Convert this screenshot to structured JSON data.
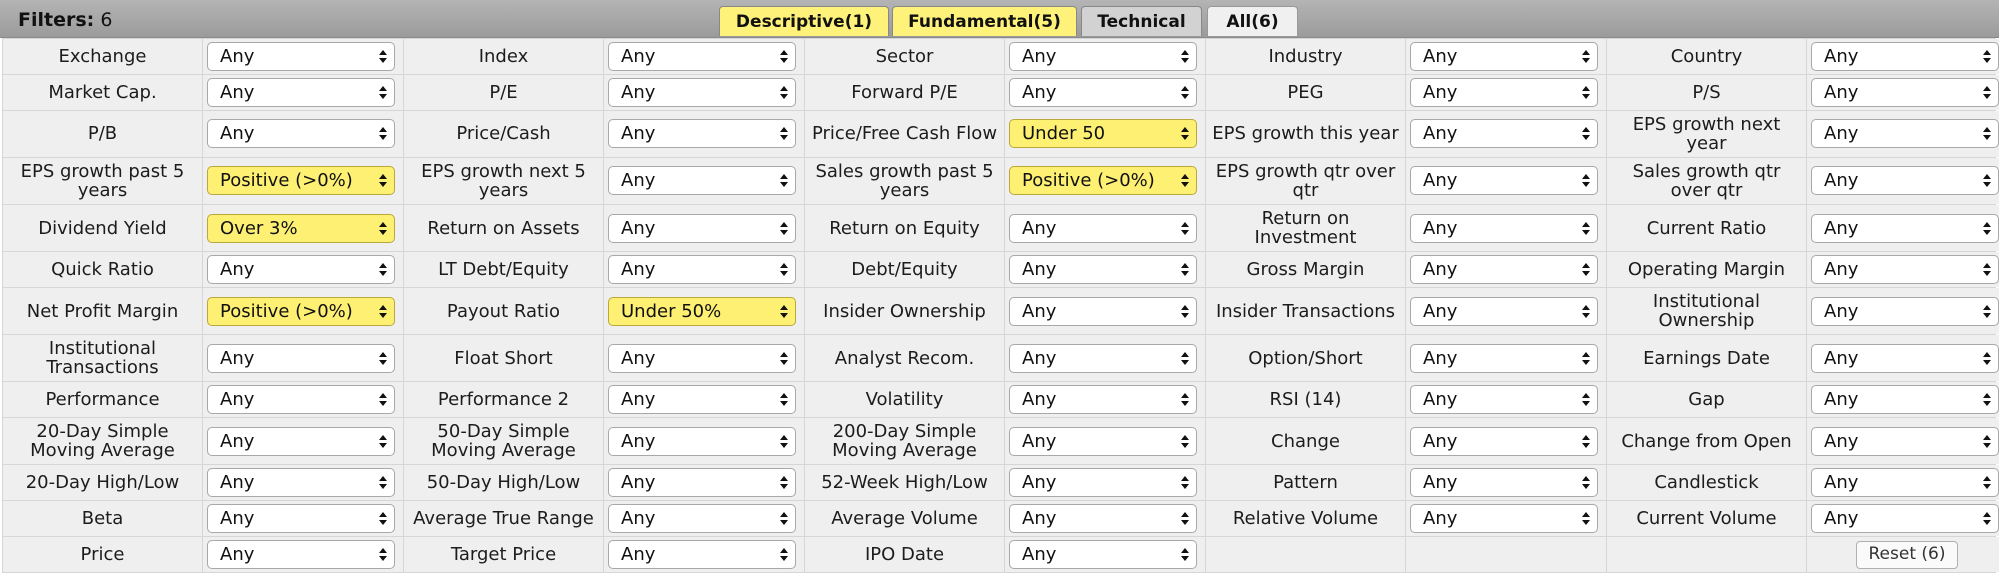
{
  "header": {
    "filters_label": "Filters:",
    "filters_count": "6",
    "tabs": [
      {
        "label": "Descriptive(1)",
        "style": "yellow"
      },
      {
        "label": "Fundamental(5)",
        "style": "yellow"
      },
      {
        "label": "Technical",
        "style": "grey"
      },
      {
        "label": "All(6)",
        "style": "active"
      }
    ],
    "colors": {
      "highlight": "#fdf072",
      "tab_yellow": "#fff27a",
      "cell_bg": "#efefef"
    }
  },
  "rows": [
    [
      {
        "label": "Exchange",
        "value": "Any"
      },
      {
        "label": "Index",
        "value": "Any"
      },
      {
        "label": "Sector",
        "value": "Any"
      },
      {
        "label": "Industry",
        "value": "Any"
      },
      {
        "label": "Country",
        "value": "Any"
      }
    ],
    [
      {
        "label": "Market Cap.",
        "value": "Any"
      },
      {
        "label": "P/E",
        "value": "Any"
      },
      {
        "label": "Forward P/E",
        "value": "Any"
      },
      {
        "label": "PEG",
        "value": "Any"
      },
      {
        "label": "P/S",
        "value": "Any"
      }
    ],
    [
      {
        "label": "P/B",
        "value": "Any"
      },
      {
        "label": "Price/Cash",
        "value": "Any"
      },
      {
        "label": "Price/Free Cash Flow",
        "value": "Under 50",
        "active": true
      },
      {
        "label": "EPS growth this year",
        "value": "Any"
      },
      {
        "label": "EPS growth next year",
        "value": "Any"
      }
    ],
    [
      {
        "label": "EPS growth past 5 years",
        "value": "Positive (>0%)",
        "active": true
      },
      {
        "label": "EPS growth next 5 years",
        "value": "Any"
      },
      {
        "label": "Sales growth past 5 years",
        "value": "Positive (>0%)",
        "active": true
      },
      {
        "label": "EPS growth qtr over qtr",
        "value": "Any"
      },
      {
        "label": "Sales growth qtr over qtr",
        "value": "Any"
      }
    ],
    [
      {
        "label": "Dividend Yield",
        "value": "Over 3%",
        "active": true
      },
      {
        "label": "Return on Assets",
        "value": "Any"
      },
      {
        "label": "Return on Equity",
        "value": "Any"
      },
      {
        "label": "Return on Investment",
        "value": "Any"
      },
      {
        "label": "Current Ratio",
        "value": "Any"
      }
    ],
    [
      {
        "label": "Quick Ratio",
        "value": "Any"
      },
      {
        "label": "LT Debt/Equity",
        "value": "Any"
      },
      {
        "label": "Debt/Equity",
        "value": "Any"
      },
      {
        "label": "Gross Margin",
        "value": "Any"
      },
      {
        "label": "Operating Margin",
        "value": "Any"
      }
    ],
    [
      {
        "label": "Net Profit Margin",
        "value": "Positive (>0%)",
        "active": true
      },
      {
        "label": "Payout Ratio",
        "value": "Under 50%",
        "active": true
      },
      {
        "label": "Insider Ownership",
        "value": "Any"
      },
      {
        "label": "Insider Transactions",
        "value": "Any"
      },
      {
        "label": "Institutional Ownership",
        "value": "Any"
      }
    ],
    [
      {
        "label": "Institutional Transactions",
        "value": "Any"
      },
      {
        "label": "Float Short",
        "value": "Any"
      },
      {
        "label": "Analyst Recom.",
        "value": "Any"
      },
      {
        "label": "Option/Short",
        "value": "Any"
      },
      {
        "label": "Earnings Date",
        "value": "Any"
      }
    ],
    [
      {
        "label": "Performance",
        "value": "Any"
      },
      {
        "label": "Performance 2",
        "value": "Any"
      },
      {
        "label": "Volatility",
        "value": "Any"
      },
      {
        "label": "RSI (14)",
        "value": "Any"
      },
      {
        "label": "Gap",
        "value": "Any"
      }
    ],
    [
      {
        "label": "20-Day Simple Moving Average",
        "value": "Any"
      },
      {
        "label": "50-Day Simple Moving Average",
        "value": "Any"
      },
      {
        "label": "200-Day Simple Moving Average",
        "value": "Any"
      },
      {
        "label": "Change",
        "value": "Any"
      },
      {
        "label": "Change from Open",
        "value": "Any"
      }
    ],
    [
      {
        "label": "20-Day High/Low",
        "value": "Any"
      },
      {
        "label": "50-Day High/Low",
        "value": "Any"
      },
      {
        "label": "52-Week High/Low",
        "value": "Any"
      },
      {
        "label": "Pattern",
        "value": "Any"
      },
      {
        "label": "Candlestick",
        "value": "Any"
      }
    ],
    [
      {
        "label": "Beta",
        "value": "Any"
      },
      {
        "label": "Average True Range",
        "value": "Any"
      },
      {
        "label": "Average Volume",
        "value": "Any"
      },
      {
        "label": "Relative Volume",
        "value": "Any"
      },
      {
        "label": "Current Volume",
        "value": "Any"
      }
    ],
    [
      {
        "label": "Price",
        "value": "Any"
      },
      {
        "label": "Target Price",
        "value": "Any"
      },
      {
        "label": "IPO Date",
        "value": "Any"
      }
    ]
  ],
  "reset_label": "Reset (6)",
  "dropdown_icon": "up-down-arrows-icon"
}
